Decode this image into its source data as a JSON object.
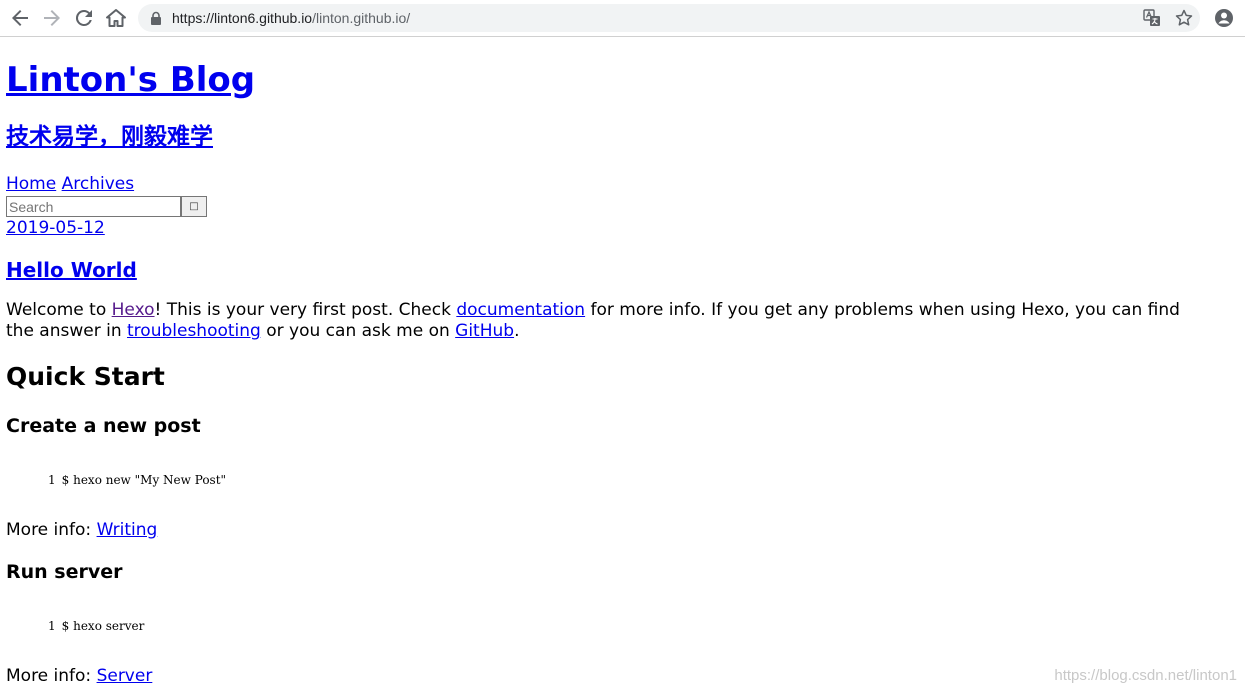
{
  "browser": {
    "url_host": "https://linton6.github.io",
    "url_path": "/linton.github.io/"
  },
  "site": {
    "title": "Linton's Blog",
    "subtitle": "技术易学，刚毅难学"
  },
  "nav": {
    "home": "Home",
    "archives": "Archives"
  },
  "search": {
    "placeholder": "Search",
    "button_glyph": "□"
  },
  "post": {
    "date": "2019-05-12",
    "title": "Hello World",
    "intro": {
      "t1": "Welcome to ",
      "link_hexo": "Hexo",
      "t2": "! This is your very first post. Check ",
      "link_docs": "documentation",
      "t3": " for more info. If you get any problems when using Hexo, you can find the answer in ",
      "link_trouble": "troubleshooting",
      "t4": " or you can ask me on ",
      "link_github": "GitHub",
      "t5": "."
    },
    "quick_start": "Quick Start",
    "sections": [
      {
        "heading": "Create a new post",
        "line_no": "1",
        "code": "$ hexo new \"My New Post\"",
        "more_label": "More info: ",
        "more_link": "Writing"
      },
      {
        "heading": "Run server",
        "line_no": "1",
        "code": "$ hexo server",
        "more_label": "More info: ",
        "more_link": "Server"
      }
    ]
  },
  "watermark": "https://blog.csdn.net/linton1"
}
